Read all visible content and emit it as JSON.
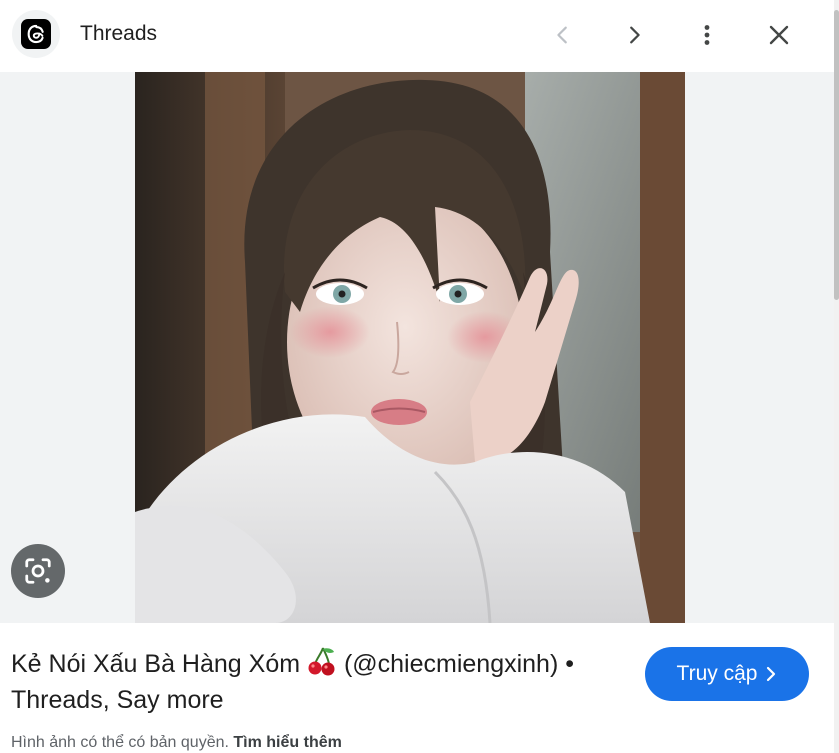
{
  "header": {
    "site_name": "Threads",
    "icons": {
      "logo": "threads-logo-icon",
      "prev": "chevron-left-icon",
      "next": "chevron-right-icon",
      "more": "more-vert-icon",
      "close": "close-icon"
    }
  },
  "image": {
    "description_icon": "lens-search-icon"
  },
  "info": {
    "title_before_emoji": "Kẻ Nói Xấu Bà Hàng Xóm ",
    "title_after_emoji": " (@chiecmiengxinh) • Threads, Say more",
    "visit_label": "Truy cập",
    "copyright_text": "Hình ảnh có thể có bản quyền.",
    "learn_more_label": "Tìm hiểu thêm"
  },
  "colors": {
    "accent": "#1a73e8",
    "image_bg": "#f1f3f4",
    "text": "#1f1f1f",
    "muted": "#5f6368"
  }
}
